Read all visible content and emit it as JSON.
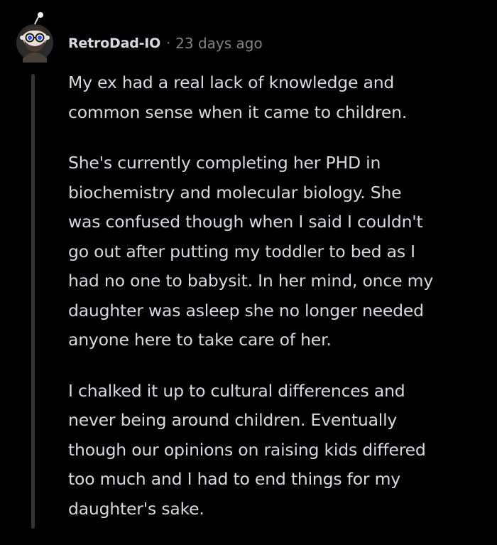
{
  "comment": {
    "username": "RetroDad-IO",
    "separator": "·",
    "timestamp": "23 days ago",
    "paragraphs": [
      {
        "lines": [
          "My ex had a real lack of knowledge and",
          "common sense when it came to children."
        ]
      },
      {
        "lines": [
          "She's currently completing her PHD in",
          "biochemistry and molecular biology. She",
          "was confused though when I said I couldn't",
          "go out after putting my toddler to bed as I",
          "had no one to babysit. In her mind, once my",
          "daughter was asleep she no longer needed",
          "anyone here to take care of her."
        ]
      },
      {
        "lines": [
          "I chalked it up to cultural differences and",
          "never being around children. Eventually",
          "though our opinions on raising kids differed",
          "too much and I had to end things for my",
          "daughter's sake."
        ]
      }
    ]
  },
  "colors": {
    "background": "#000000",
    "text": "#d7dadc",
    "meta": "#818384",
    "thread_line": "#343536"
  },
  "avatar": {
    "icon": "snoo-avatar-icon"
  }
}
